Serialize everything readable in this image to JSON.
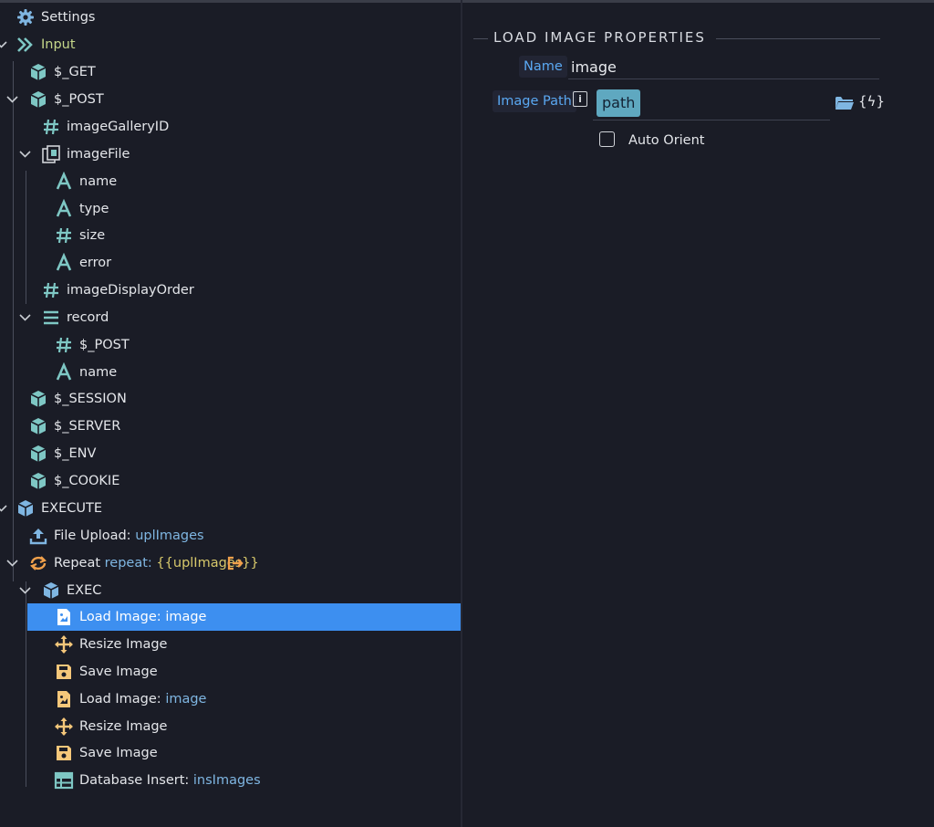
{
  "tree": {
    "items": [
      {
        "id": "settings",
        "label": "Settings"
      },
      {
        "id": "input",
        "label": "Input"
      },
      {
        "id": "get",
        "label": "$_GET"
      },
      {
        "id": "post",
        "label": "$_POST"
      },
      {
        "id": "imageGalleryID",
        "label": "imageGalleryID"
      },
      {
        "id": "imageFile",
        "label": "imageFile"
      },
      {
        "id": "name",
        "label": "name"
      },
      {
        "id": "type",
        "label": "type"
      },
      {
        "id": "size",
        "label": "size"
      },
      {
        "id": "error",
        "label": "error"
      },
      {
        "id": "imageDisplayOrder",
        "label": "imageDisplayOrder"
      },
      {
        "id": "record",
        "label": "record"
      },
      {
        "id": "record_post",
        "label": "$_POST"
      },
      {
        "id": "record_name",
        "label": "name"
      },
      {
        "id": "session",
        "label": "$_SESSION"
      },
      {
        "id": "server",
        "label": "$_SERVER"
      },
      {
        "id": "env",
        "label": "$_ENV"
      },
      {
        "id": "cookie",
        "label": "$_COOKIE"
      },
      {
        "id": "execute",
        "label": "EXECUTE"
      },
      {
        "id": "file_upload",
        "label": "File Upload:",
        "detail": "uplImages"
      },
      {
        "id": "repeat",
        "label": "Repeat",
        "detail": "repeat:",
        "detail2": "{{uplImages}}"
      },
      {
        "id": "exec",
        "label": "EXEC"
      },
      {
        "id": "load_image_1",
        "label": "Load Image:",
        "detail": "image"
      },
      {
        "id": "resize_image_1",
        "label": "Resize Image"
      },
      {
        "id": "save_image_1",
        "label": "Save Image"
      },
      {
        "id": "load_image_2",
        "label": "Load Image:",
        "detail": "image"
      },
      {
        "id": "resize_image_2",
        "label": "Resize Image"
      },
      {
        "id": "save_image_2",
        "label": "Save Image"
      },
      {
        "id": "db_insert",
        "label": "Database Insert:",
        "detail": "insImages"
      }
    ]
  },
  "properties": {
    "section_title": "LOAD IMAGE PROPERTIES",
    "name_label": "Name",
    "name_value": "image",
    "image_path_label": "Image Path",
    "info_glyph": "i",
    "image_path_value": "path",
    "dynamic_glyph": "{ϟ}",
    "auto_orient_label": "Auto Orient"
  },
  "colors": {
    "background": "#1a1c26",
    "selection": "#3d8ff0",
    "label_blue": "#5aa8f2",
    "icon_teal": "#7ec7c4",
    "icon_orange": "#f0a04b"
  }
}
